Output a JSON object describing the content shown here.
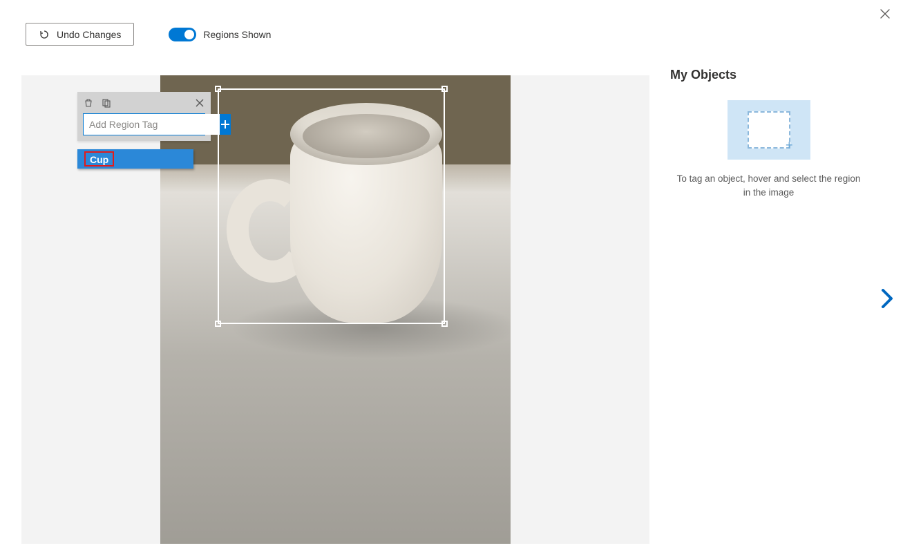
{
  "topbar": {
    "undo_label": "Undo Changes",
    "toggle_label": "Regions Shown"
  },
  "tag_panel": {
    "placeholder": "Add Region Tag"
  },
  "suggestions": {
    "items": [
      "Cup"
    ]
  },
  "sidebar": {
    "title": "My Objects",
    "help_text": "To tag an object, hover and select the region in the image"
  }
}
